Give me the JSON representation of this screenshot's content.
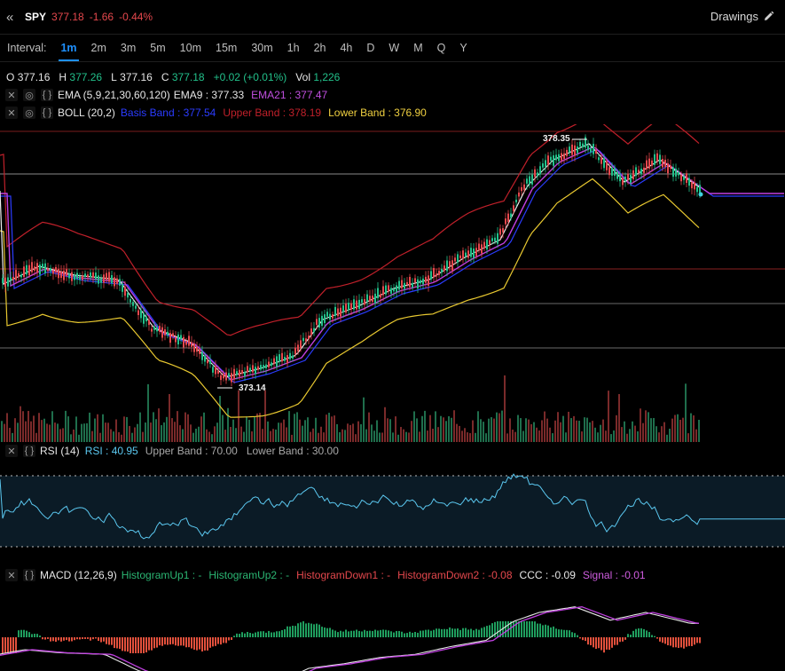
{
  "header": {
    "symbol": "SPY",
    "last": "377.18",
    "change": "-1.66",
    "change_pct": "-0.44%",
    "drawings_label": "Drawings"
  },
  "intervals": {
    "label": "Interval:",
    "items": [
      "1m",
      "2m",
      "3m",
      "5m",
      "10m",
      "15m",
      "30m",
      "1h",
      "2h",
      "4h",
      "D",
      "W",
      "M",
      "Q",
      "Y"
    ],
    "active": "1m"
  },
  "ohlc": {
    "o_label": "O",
    "o": "377.16",
    "h_label": "H",
    "h": "377.26",
    "l_label": "L",
    "l": "377.16",
    "c_label": "C",
    "c": "377.18",
    "chg": "+0.02 (+0.01%)",
    "vol_label": "Vol",
    "vol": "1,226"
  },
  "ema": {
    "name": "EMA (5,9,21,30,60,120)",
    "ema9": "EMA9 : 377.33",
    "ema21": "EMA21 : 377.47"
  },
  "boll": {
    "name": "BOLL (20,2)",
    "basis": "Basis Band : 377.54",
    "upper": "Upper Band : 378.19",
    "lower": "Lower Band : 376.90"
  },
  "annotations": {
    "high": "378.35",
    "low": "373.14"
  },
  "rsi": {
    "name": "RSI (14)",
    "value": "RSI : 40.95",
    "upper": "Upper Band : 70.00",
    "lower": "Lower Band : 30.00"
  },
  "macd": {
    "name": "MACD (12,26,9)",
    "hu1": "HistogramUp1 : -",
    "hu2": "HistogramUp2 : -",
    "hd1": "HistogramDown1 : -",
    "hd2": "HistogramDown2 : -0.08",
    "ccc": "CCC : -0.09",
    "signal": "Signal : -0.01"
  },
  "colors": {
    "up": "#22c08a",
    "down": "#e5484d",
    "accent": "#1e90ff",
    "boll_band": "#c0202a",
    "boll_lower": "#e8c830",
    "ema9": "#f0f0f0",
    "ema21": "#c040e0",
    "basis": "#2b3cff",
    "rsi": "#5bc8f0"
  }
}
